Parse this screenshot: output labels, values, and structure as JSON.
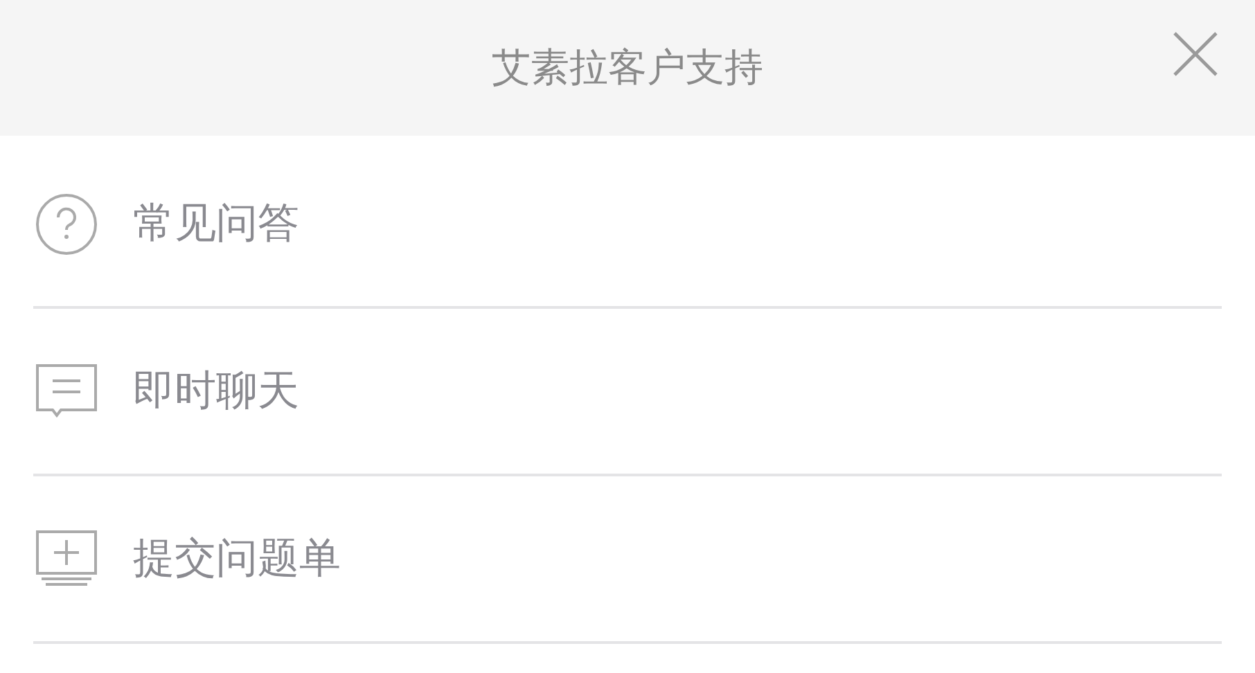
{
  "header": {
    "title": "艾素拉客户支持"
  },
  "menu": [
    {
      "kind": "faq",
      "label": "常见问答"
    },
    {
      "kind": "chat",
      "label": "即时聊天"
    },
    {
      "kind": "ticket",
      "label": "提交问题单"
    }
  ]
}
